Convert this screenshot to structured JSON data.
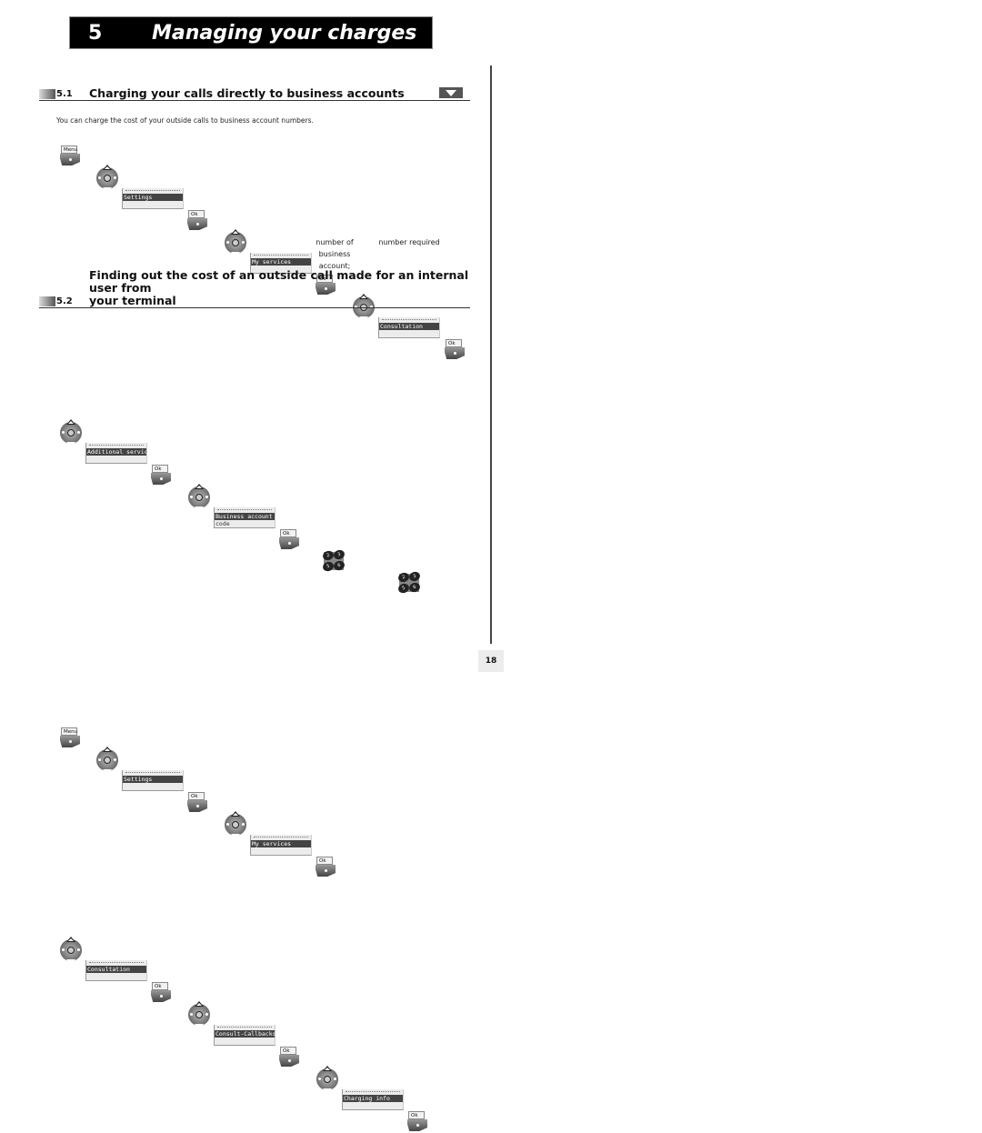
{
  "chapter": {
    "number": "5",
    "title": "Managing your charges"
  },
  "section1": {
    "number": "5.1",
    "title": "Charging your calls directly to business accounts",
    "intro": "You can charge the cost of your outside calls to business account numbers.",
    "row1": {
      "menu_key": "Menu",
      "screens": [
        "Settings",
        "My services",
        "Consultation"
      ],
      "ok_key": "Ok"
    },
    "row2": {
      "screens": [
        {
          "line1": "Additional services",
          "line2": ""
        },
        {
          "line1": "Business account",
          "line2": "code"
        }
      ],
      "ok_key": "Ok",
      "keypad_keys": [
        "2",
        "3",
        "5",
        "6"
      ],
      "captions": [
        "number of business account;",
        "number required"
      ]
    }
  },
  "section2": {
    "number": "5.2",
    "title_line1": "Finding out the cost of an outside call made for an internal user from",
    "title_line2": "your terminal",
    "row1": {
      "menu_key": "Menu",
      "screens": [
        "Settings",
        "My services"
      ],
      "ok_key": "Ok"
    },
    "row2": {
      "screens": [
        "Consultation",
        "Consult-Callbacks",
        "Charging info"
      ],
      "ok_key": "Ok"
    }
  },
  "page_number": "18"
}
